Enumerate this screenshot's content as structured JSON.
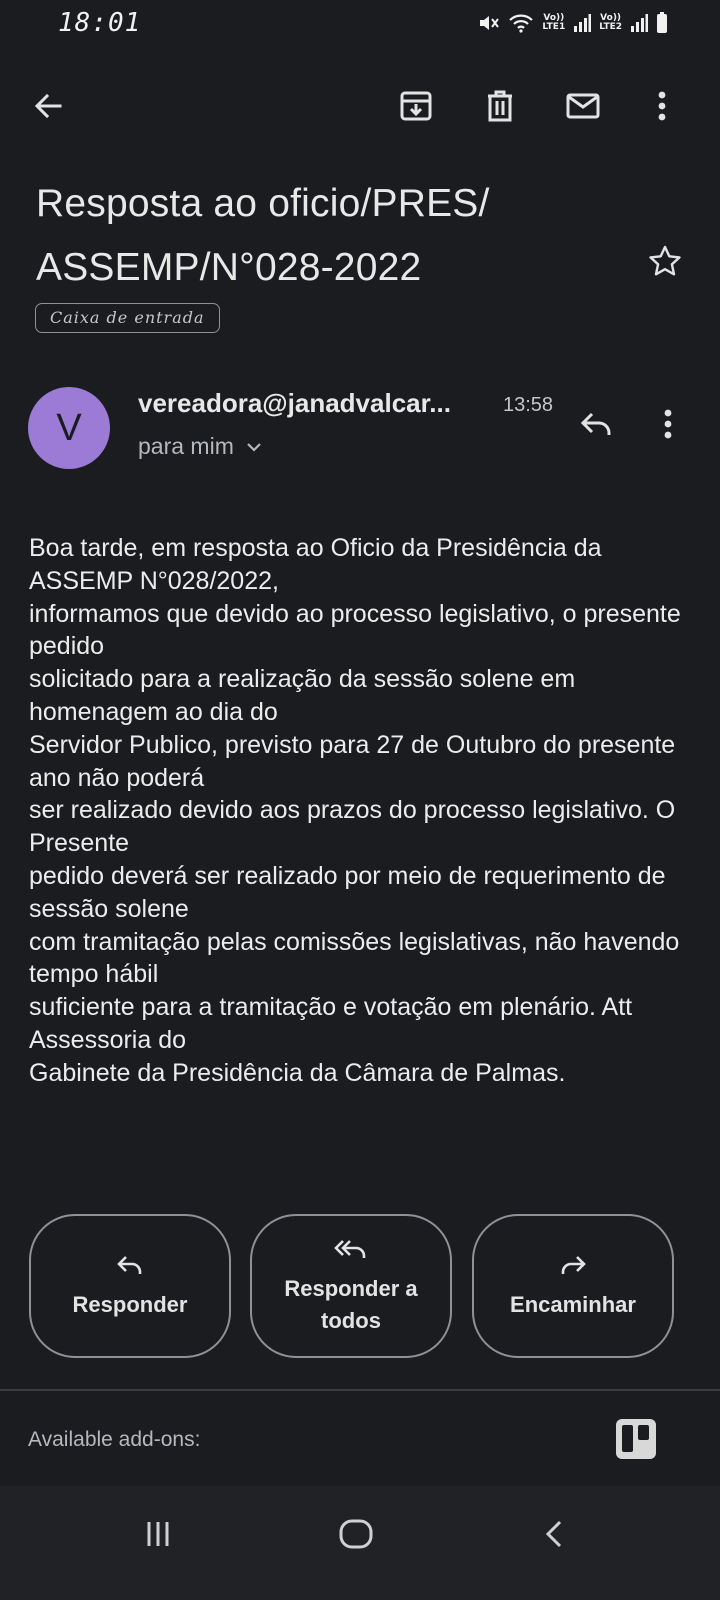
{
  "status_bar": {
    "time": "18:01",
    "sim1": "LTE1",
    "sim2": "LTE2",
    "volte": "Vo))"
  },
  "toolbar": {
    "back_icon": "arrow-left-icon",
    "archive_icon": "archive-icon",
    "delete_icon": "trash-icon",
    "mark_unread_icon": "mail-icon",
    "more_icon": "more-vert-icon"
  },
  "email": {
    "subject_line1": "Resposta ao oficio/PRES/",
    "subject_line2": "ASSEMP/N°028-2022",
    "label": "Caixa de entrada",
    "avatar_letter": "V",
    "avatar_color": "#9b7bd6",
    "sender": "vereadora@janadvalcar...",
    "time": "13:58",
    "recipient": "para mim",
    "body_lines": [
      "Boa tarde, em resposta ao Oficio da Presidência da ASSEMP N°028/2022,",
      "informamos que devido ao processo legislativo, o presente pedido",
      "solicitado para a realização da sessão solene em homenagem ao dia do",
      "Servidor Publico, previsto para 27 de Outubro do presente ano não poderá",
      "ser realizado devido aos prazos do processo legislativo. O Presente",
      "pedido deverá ser realizado por meio de requerimento de sessão solene",
      "com tramitação pelas comissões legislativas, não havendo tempo hábil",
      "suficiente para a tramitação e votação em plenário. Att Assessoria do",
      "Gabinete da Presidência da Câmara de Palmas."
    ]
  },
  "actions": {
    "reply": "Responder",
    "reply_all": "Responder a todos",
    "forward": "Encaminhar"
  },
  "addons": {
    "label": "Available add-ons:",
    "icon": "trello-icon"
  },
  "navbar": {
    "recents_icon": "recents-icon",
    "home_icon": "home-icon",
    "back_icon": "nav-back-icon"
  },
  "colors": {
    "background": "#1b1c1f",
    "text": "#e3e3e3",
    "outline": "#8e9196"
  }
}
